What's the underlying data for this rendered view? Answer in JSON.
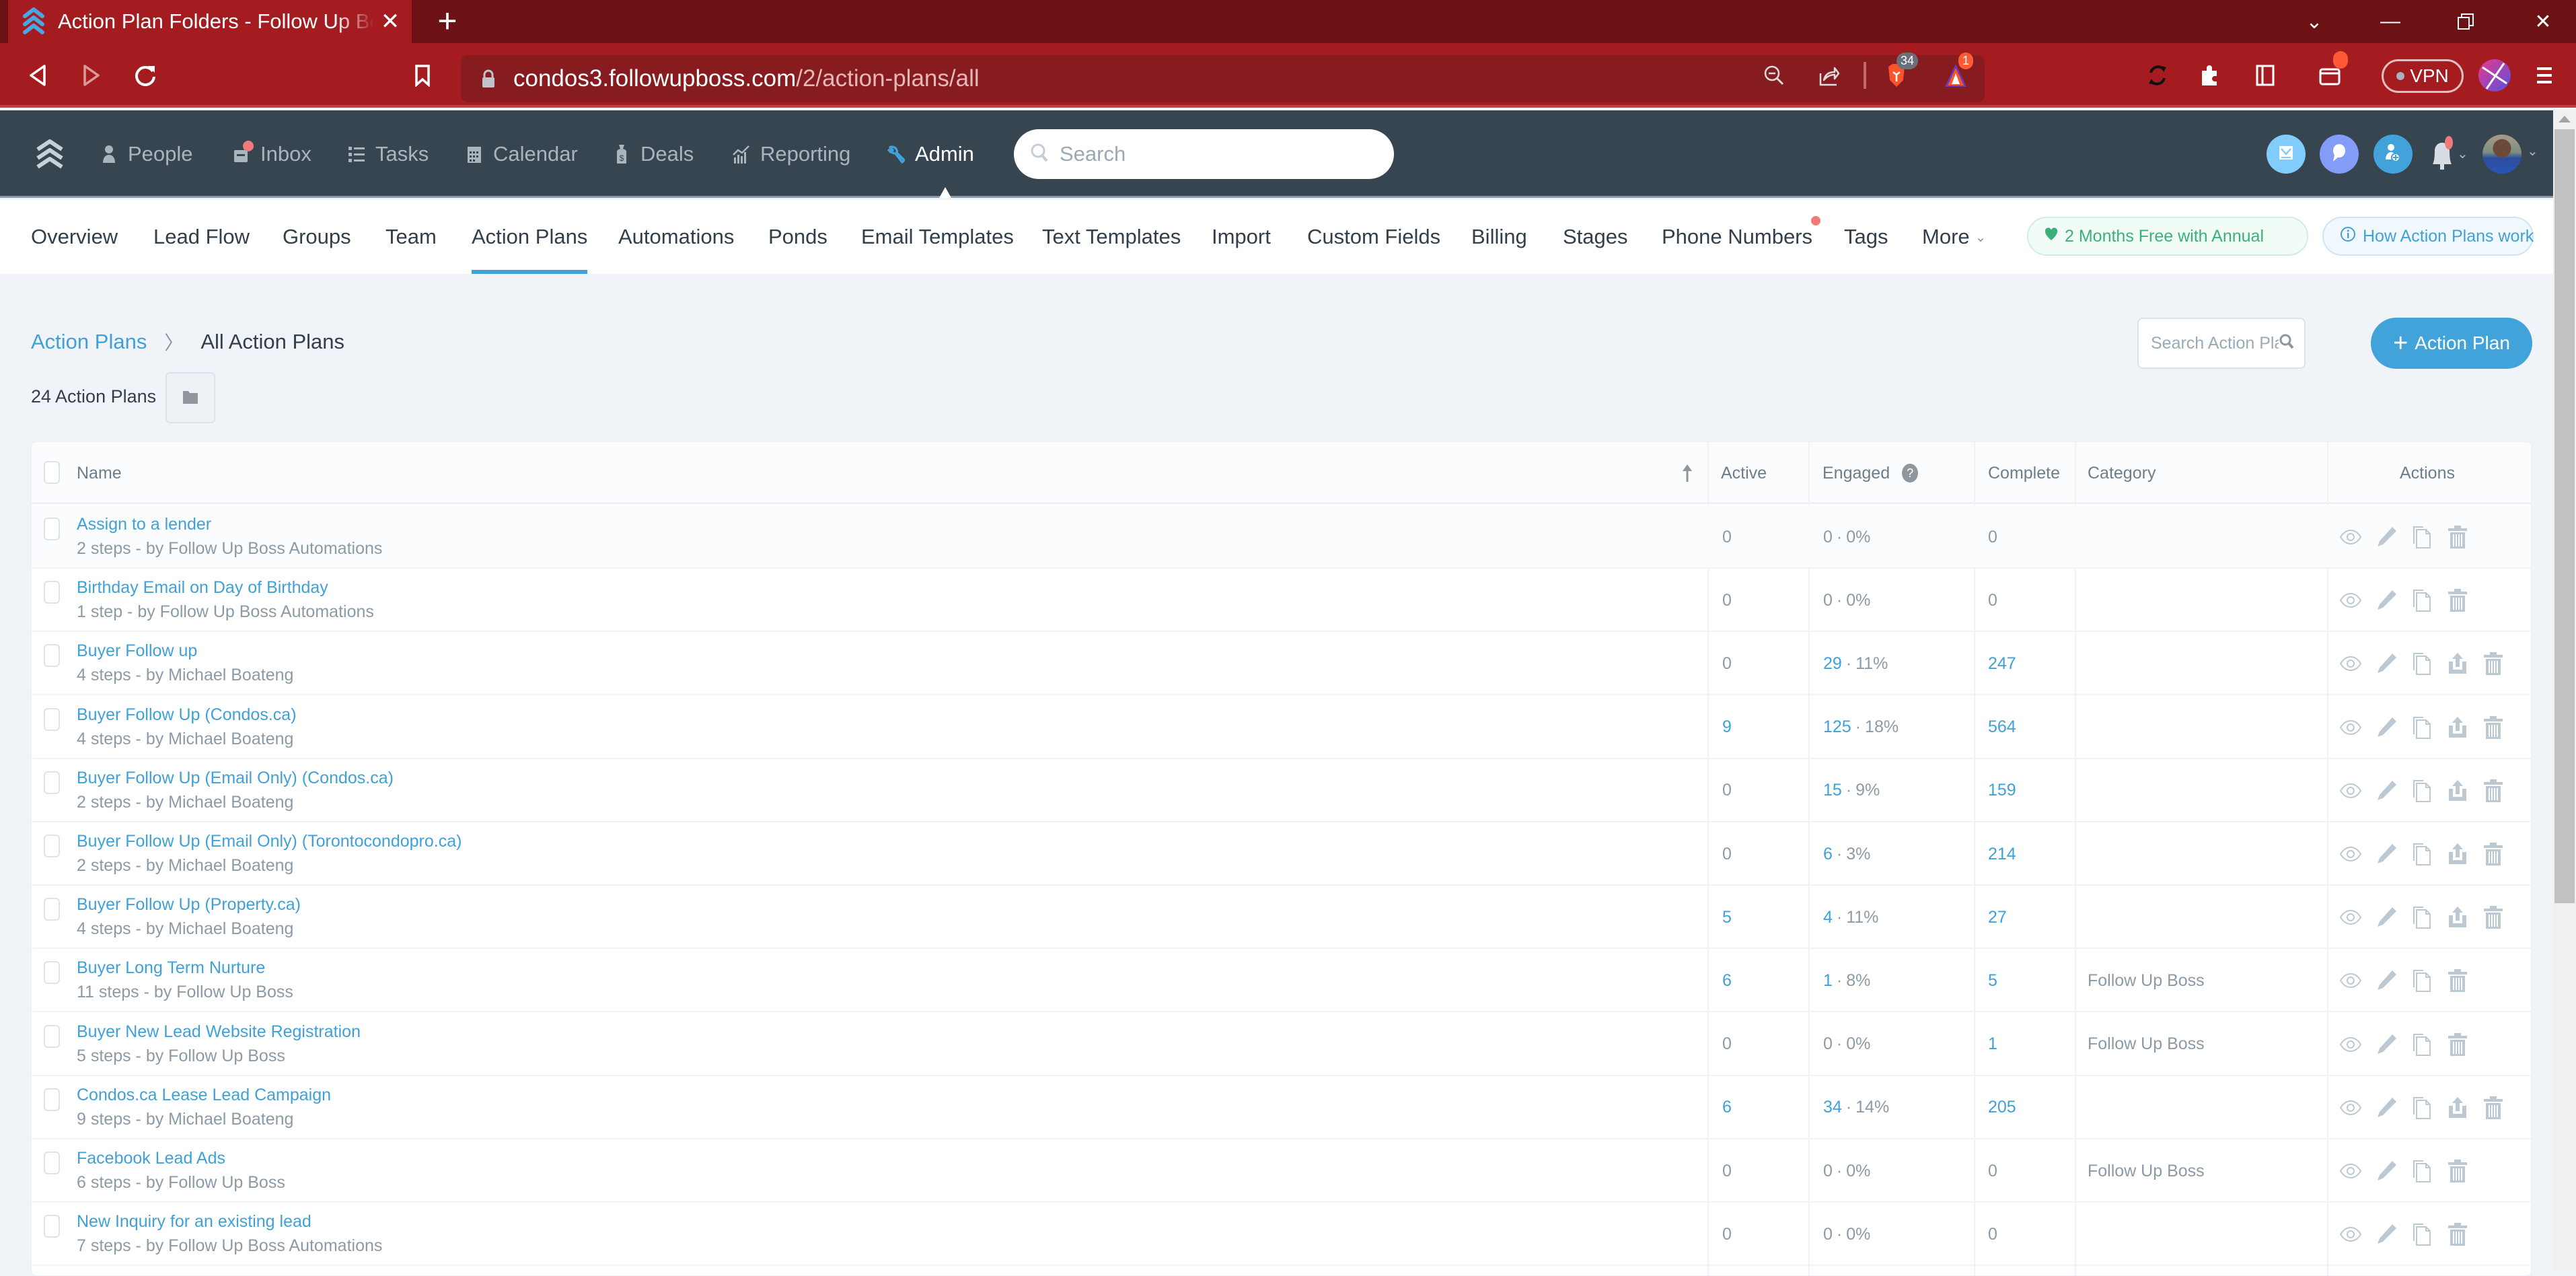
{
  "browser": {
    "tab_title": "Action Plan Folders - Follow Up Boss",
    "url_host": "condos3.followupboss.com",
    "url_path": "/2/action-plans/all",
    "brave_badge": "34",
    "alert_badge": "1",
    "vpn_label": "VPN"
  },
  "appnav": {
    "items": [
      {
        "label": "People",
        "icon": "person-icon"
      },
      {
        "label": "Inbox",
        "icon": "inbox-icon"
      },
      {
        "label": "Tasks",
        "icon": "tasks-list-icon"
      },
      {
        "label": "Calendar",
        "icon": "calendar-icon"
      },
      {
        "label": "Deals",
        "icon": "deals-bag-icon"
      },
      {
        "label": "Reporting",
        "icon": "reporting-chart-icon"
      },
      {
        "label": "Admin",
        "icon": "wrench-icon"
      }
    ],
    "active": "Admin",
    "search_placeholder": "Search"
  },
  "subnav": {
    "items": [
      "Overview",
      "Lead Flow",
      "Groups",
      "Team",
      "Action Plans",
      "Automations",
      "Ponds",
      "Email Templates",
      "Text Templates",
      "Import",
      "Custom Fields",
      "Billing",
      "Stages",
      "Phone Numbers",
      "Tags",
      "More"
    ],
    "active": "Action Plans",
    "promo_label": "2 Months Free with Annual",
    "help_label": "How Action Plans work"
  },
  "page": {
    "breadcrumb_root": "Action Plans",
    "breadcrumb_current": "All Action Plans",
    "count_label": "24 Action Plans",
    "search_placeholder": "Search Action Plans",
    "add_button_label": "Action Plan"
  },
  "table": {
    "columns": {
      "name": "Name",
      "active": "Active",
      "engaged": "Engaged",
      "complete": "Complete",
      "category": "Category",
      "actions": "Actions"
    },
    "sort": "name-ascending",
    "rows": [
      {
        "name": "Assign to a lender",
        "meta": "2 steps - by Follow Up Boss Automations",
        "active": "0",
        "engaged": "0",
        "engaged_pct": "0%",
        "complete": "0",
        "category": "",
        "shareable": false
      },
      {
        "name": "Birthday Email on Day of Birthday",
        "meta": "1 step - by Follow Up Boss Automations",
        "active": "0",
        "engaged": "0",
        "engaged_pct": "0%",
        "complete": "0",
        "category": "",
        "shareable": false
      },
      {
        "name": "Buyer Follow up",
        "meta": "4 steps - by Michael Boateng",
        "active": "0",
        "engaged": "29",
        "engaged_pct": "11%",
        "complete": "247",
        "category": "",
        "shareable": true
      },
      {
        "name": "Buyer Follow Up (Condos.ca)",
        "meta": "4 steps - by Michael Boateng",
        "active": "9",
        "engaged": "125",
        "engaged_pct": "18%",
        "complete": "564",
        "category": "",
        "shareable": true
      },
      {
        "name": "Buyer Follow Up (Email Only) (Condos.ca)",
        "meta": "2 steps - by Michael Boateng",
        "active": "0",
        "engaged": "15",
        "engaged_pct": "9%",
        "complete": "159",
        "category": "",
        "shareable": true
      },
      {
        "name": "Buyer Follow Up (Email Only) (Torontocondopro.ca)",
        "meta": "2 steps - by Michael Boateng",
        "active": "0",
        "engaged": "6",
        "engaged_pct": "3%",
        "complete": "214",
        "category": "",
        "shareable": true
      },
      {
        "name": "Buyer Follow Up (Property.ca)",
        "meta": "4 steps - by Michael Boateng",
        "active": "5",
        "engaged": "4",
        "engaged_pct": "11%",
        "complete": "27",
        "category": "",
        "shareable": true
      },
      {
        "name": "Buyer Long Term Nurture",
        "meta": "11 steps - by Follow Up Boss",
        "active": "6",
        "engaged": "1",
        "engaged_pct": "8%",
        "complete": "5",
        "category": "Follow Up Boss",
        "shareable": false
      },
      {
        "name": "Buyer New Lead Website Registration",
        "meta": "5 steps - by Follow Up Boss",
        "active": "0",
        "engaged": "0",
        "engaged_pct": "0%",
        "complete": "1",
        "category": "Follow Up Boss",
        "shareable": false
      },
      {
        "name": "Condos.ca Lease Lead Campaign",
        "meta": "9 steps - by Michael Boateng",
        "active": "6",
        "engaged": "34",
        "engaged_pct": "14%",
        "complete": "205",
        "category": "",
        "shareable": true
      },
      {
        "name": "Facebook Lead Ads",
        "meta": "6 steps - by Follow Up Boss",
        "active": "0",
        "engaged": "0",
        "engaged_pct": "0%",
        "complete": "0",
        "category": "Follow Up Boss",
        "shareable": false
      },
      {
        "name": "New Inquiry for an existing lead",
        "meta": "7 steps - by Follow Up Boss Automations",
        "active": "0",
        "engaged": "0",
        "engaged_pct": "0%",
        "complete": "0",
        "category": "",
        "shareable": false
      }
    ]
  },
  "colors": {
    "browser_red": "#a51c20",
    "nav_dark": "#364550",
    "accent_blue": "#3fa1d8",
    "promo_green": "#3bb07b",
    "muted_text": "#8c9aa6",
    "icon_gray": "#bcc8d2"
  }
}
